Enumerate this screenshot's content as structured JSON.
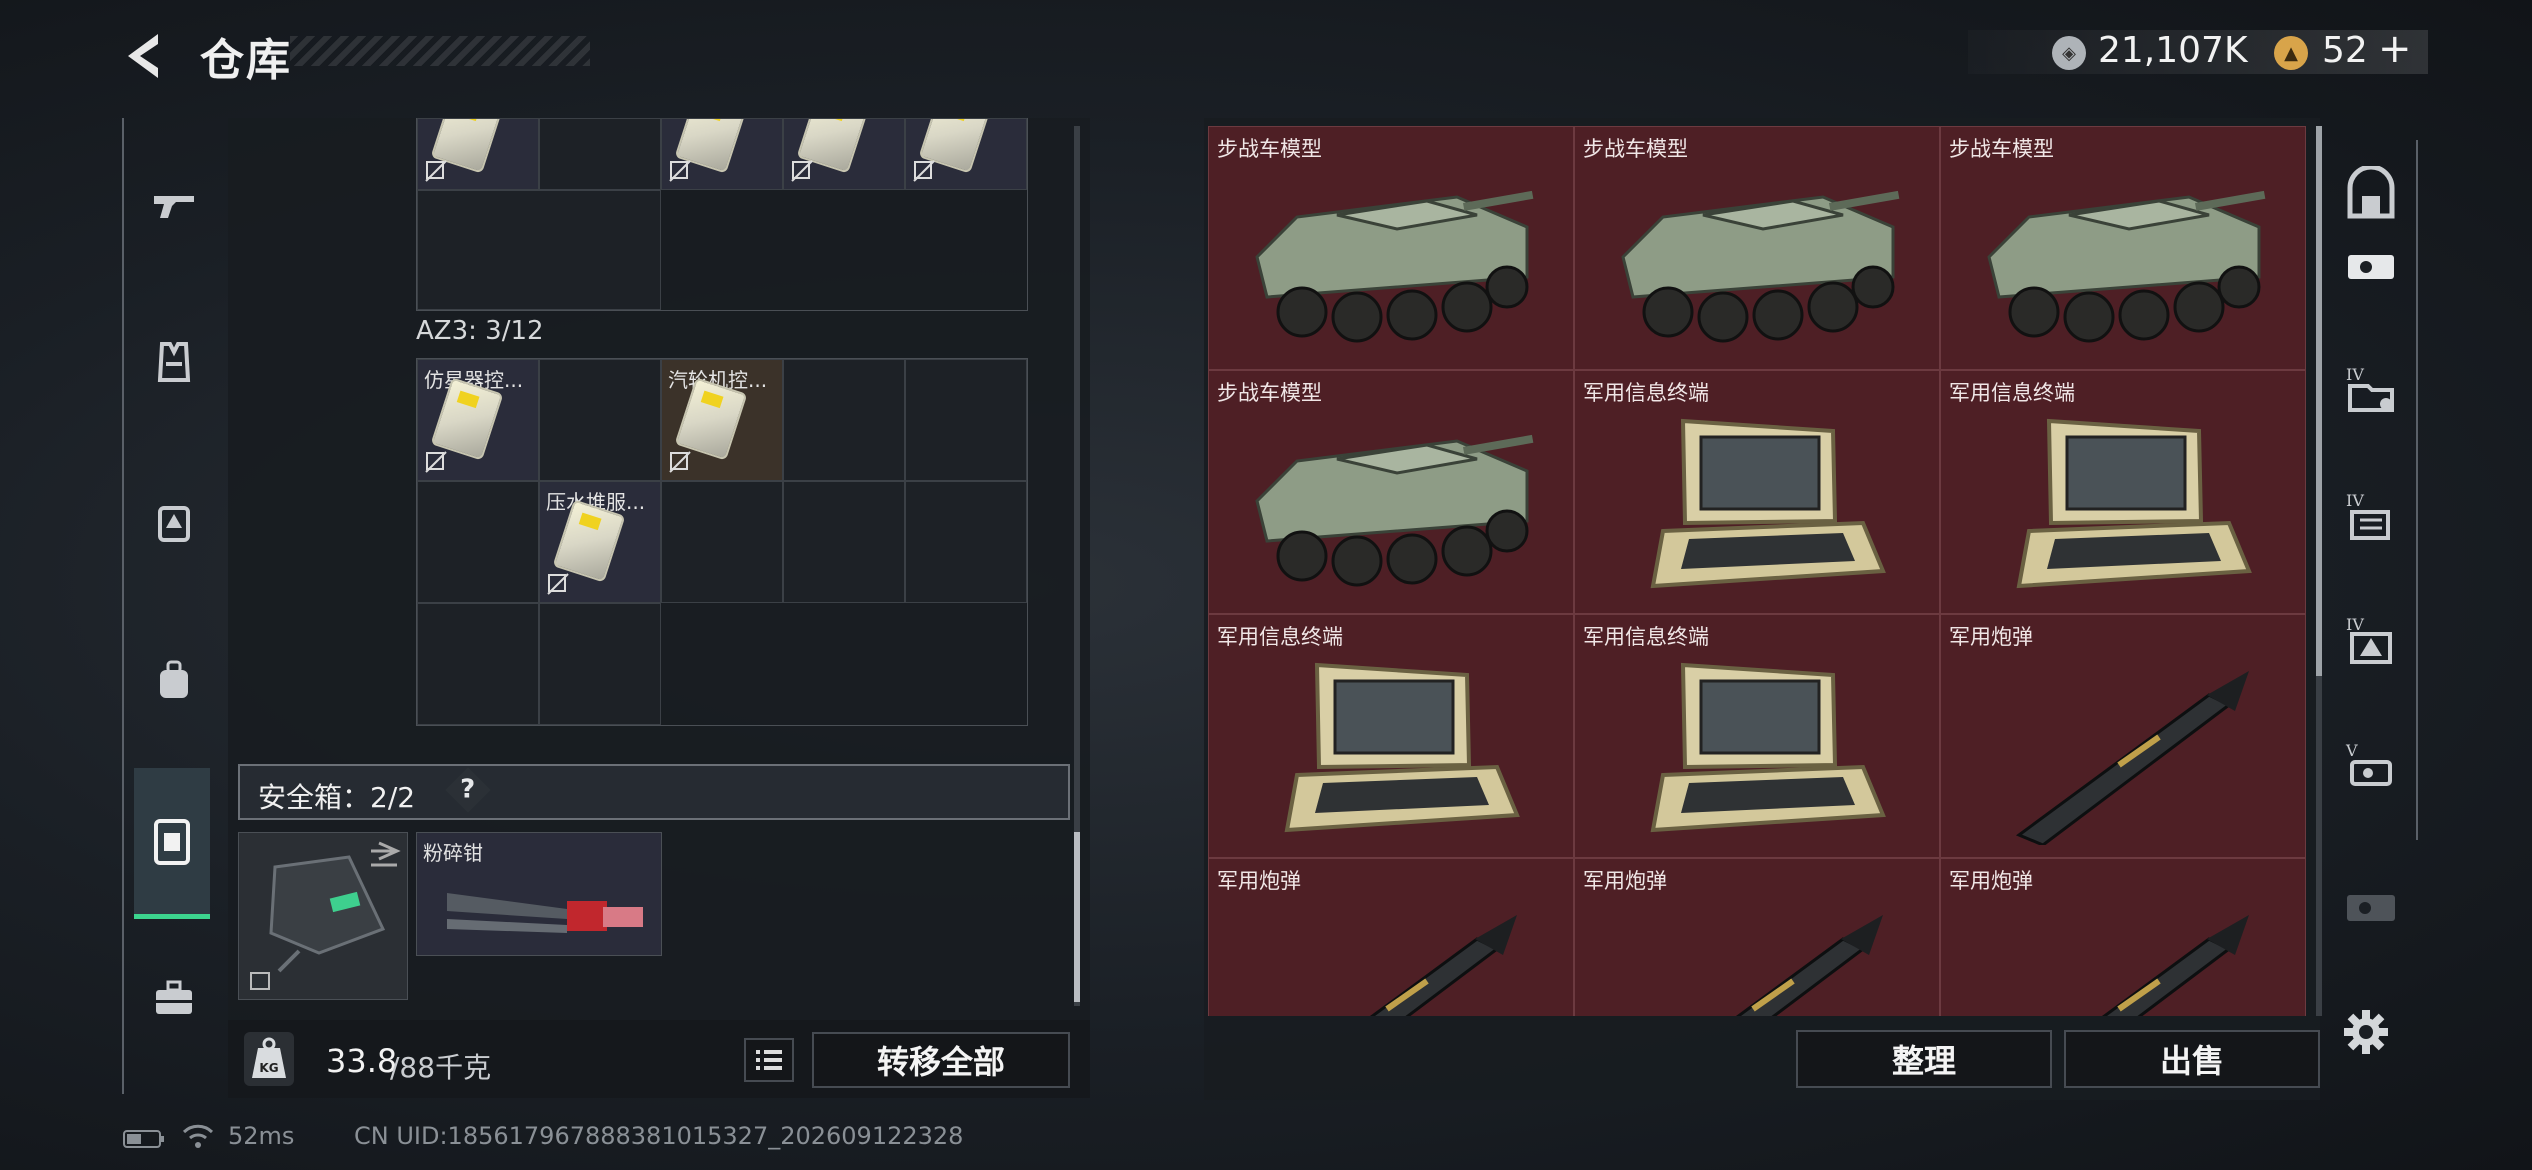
{
  "header": {
    "title": "仓库",
    "currencies": [
      {
        "icon": "silver-coin-icon",
        "value": "21,107K",
        "color": "#c8ccd0"
      },
      {
        "icon": "gold-triangle-coin-icon",
        "value": "52",
        "color": "#d8a44a"
      }
    ],
    "add_symbol": "+"
  },
  "left_tabs": [
    {
      "icon": "gun-icon",
      "active": false
    },
    {
      "icon": "armor-vest-icon",
      "active": false
    },
    {
      "icon": "chest-rig-icon",
      "active": false
    },
    {
      "icon": "backpack-icon",
      "active": false
    },
    {
      "icon": "safebox-icon",
      "active": true
    },
    {
      "icon": "toolbox-icon",
      "active": false
    }
  ],
  "storage": {
    "az3_label": "AZ3: 3/12",
    "az3_items": [
      {
        "label": "仿星器控..."
      },
      {
        "label": "汽轮机控..."
      },
      {
        "label": "压水堆服..."
      }
    ],
    "safebox_label": "安全箱：2/2",
    "help": "?",
    "safebox_items": [
      {
        "label": "",
        "icon": "safebox-case-icon"
      },
      {
        "label": "粉碎钳",
        "icon": "hydraulic-cutter-icon"
      }
    ],
    "weight_current": "33.8",
    "weight_max": "/88千克",
    "kg_badge": "KG",
    "transfer_all": "转移全部"
  },
  "loot_grid": [
    {
      "label": "步战车模型",
      "art": "ifv-model"
    },
    {
      "label": "步战车模型",
      "art": "ifv-model"
    },
    {
      "label": "步战车模型",
      "art": "ifv-model"
    },
    {
      "label": "步战车模型",
      "art": "ifv-model"
    },
    {
      "label": "军用信息终端",
      "art": "terminal"
    },
    {
      "label": "军用信息终端",
      "art": "terminal"
    },
    {
      "label": "军用信息终端",
      "art": "terminal"
    },
    {
      "label": "军用信息终端",
      "art": "terminal"
    },
    {
      "label": "军用炮弹",
      "art": "shell"
    },
    {
      "label": "军用炮弹",
      "art": "shell"
    },
    {
      "label": "军用炮弹",
      "art": "shell"
    },
    {
      "label": "军用炮弹",
      "art": "shell"
    }
  ],
  "right_actions": {
    "organize": "整理",
    "sell": "出售"
  },
  "right_tabs": [
    {
      "icon": "vault-icon"
    },
    {
      "icon": "ticket-icon"
    },
    {
      "icon": "tier-iv-folder-icon",
      "tier": "IV"
    },
    {
      "icon": "tier-iv-files-icon",
      "tier": "IV"
    },
    {
      "icon": "tier-iv-warning-icon",
      "tier": "IV"
    },
    {
      "icon": "tier-v-ticket-icon",
      "tier": "V"
    },
    {
      "icon": "dim-ticket-icon"
    },
    {
      "icon": "gear-icon"
    }
  ],
  "footer": {
    "ping": "52ms",
    "uid": "CN UID:18561796788838101​5327_202609122328"
  }
}
